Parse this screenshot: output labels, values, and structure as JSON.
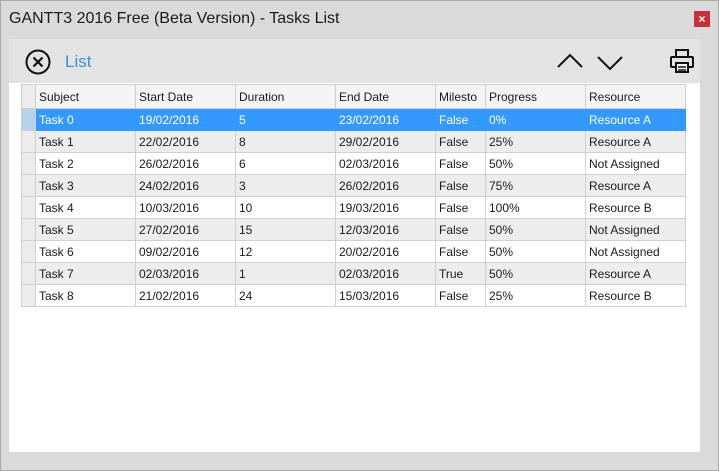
{
  "window": {
    "title": "GANTT3 2016 Free (Beta Version) - Tasks List",
    "close_glyph": "×"
  },
  "toolbar": {
    "close_icon": "circle-x-icon",
    "list_label": "List",
    "up_icon": "chevron-up-icon",
    "down_icon": "chevron-down-icon",
    "print_icon": "printer-icon",
    "accent_color": "#2e95d6"
  },
  "table": {
    "columns": [
      "Subject",
      "Start Date",
      "Duration",
      "End Date",
      "Milesto",
      "Progress",
      "Resource"
    ],
    "selected_row": 0,
    "selection_color": "#3399ff",
    "rows": [
      [
        "Task 0",
        "19/02/2016",
        "5",
        "23/02/2016",
        "False",
        "0%",
        "Resource A"
      ],
      [
        "Task 1",
        "22/02/2016",
        "8",
        "29/02/2016",
        "False",
        "25%",
        "Resource A"
      ],
      [
        "Task 2",
        "26/02/2016",
        "6",
        "02/03/2016",
        "False",
        "50%",
        "Not Assigned"
      ],
      [
        "Task 3",
        "24/02/2016",
        "3",
        "26/02/2016",
        "False",
        "75%",
        "Resource A"
      ],
      [
        "Task 4",
        "10/03/2016",
        "10",
        "19/03/2016",
        "False",
        "100%",
        "Resource B"
      ],
      [
        "Task 5",
        "27/02/2016",
        "15",
        "12/03/2016",
        "False",
        "50%",
        "Not Assigned"
      ],
      [
        "Task 6",
        "09/02/2016",
        "12",
        "20/02/2016",
        "False",
        "50%",
        "Not Assigned"
      ],
      [
        "Task 7",
        "02/03/2016",
        "1",
        "02/03/2016",
        "True",
        "50%",
        "Resource A"
      ],
      [
        "Task 8",
        "21/02/2016",
        "24",
        "15/03/2016",
        "False",
        "25%",
        "Resource B"
      ]
    ]
  }
}
